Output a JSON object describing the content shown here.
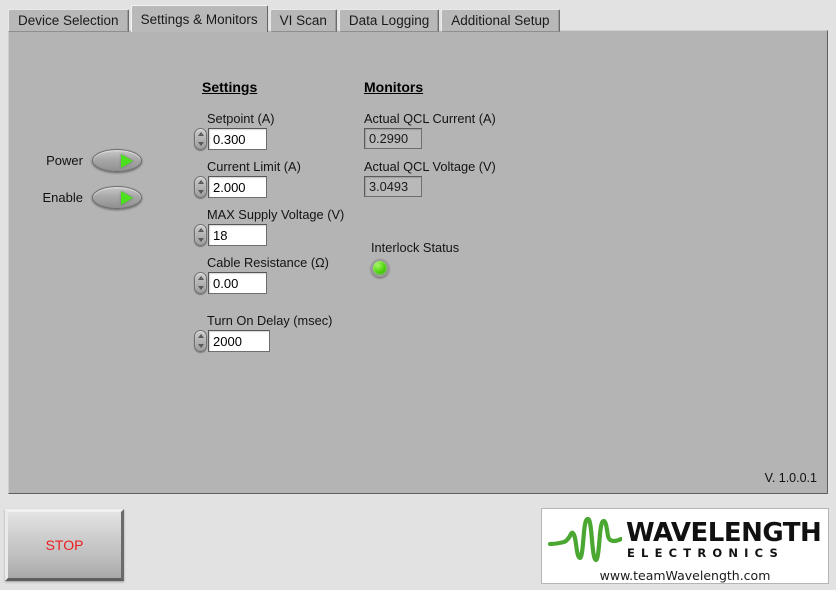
{
  "window": {
    "version_text": "V. 1.0.0.1"
  },
  "tabs": [
    {
      "label": "Device Selection",
      "active": false
    },
    {
      "label": "Settings & Monitors",
      "active": true
    },
    {
      "label": "VI Scan",
      "active": false
    },
    {
      "label": "Data Logging",
      "active": false
    },
    {
      "label": "Additional Setup",
      "active": false
    }
  ],
  "switches": [
    {
      "label": "Power",
      "state": "on",
      "icon": "play-triangle-icon"
    },
    {
      "label": "Enable",
      "state": "on",
      "icon": "play-triangle-icon"
    }
  ],
  "settings": {
    "heading": "Settings",
    "fields": [
      {
        "label": "Setpoint (A)",
        "value": "0.300"
      },
      {
        "label": "Current Limit (A)",
        "value": "2.000"
      },
      {
        "label": "MAX Supply Voltage (V)",
        "value": "18"
      },
      {
        "label": "Cable Resistance (Ω)",
        "value": "0.00"
      },
      {
        "label": "Turn On Delay (msec)",
        "value": "2000"
      }
    ]
  },
  "monitors": {
    "heading": "Monitors",
    "readouts": [
      {
        "label": "Actual QCL Current (A)",
        "value": "0.2990"
      },
      {
        "label": "Actual QCL Voltage (V)",
        "value": "3.0493"
      }
    ],
    "interlock": {
      "label": "Interlock Status",
      "state": "ok",
      "color": "#4fd318"
    }
  },
  "stop_button": {
    "label": "STOP",
    "color": "#ee1c1c"
  },
  "logo": {
    "name": "WAVELENGTH",
    "subtitle": "ELECTRONICS",
    "url": "www.teamWavelength.com",
    "wave_color": "#4aa832"
  }
}
